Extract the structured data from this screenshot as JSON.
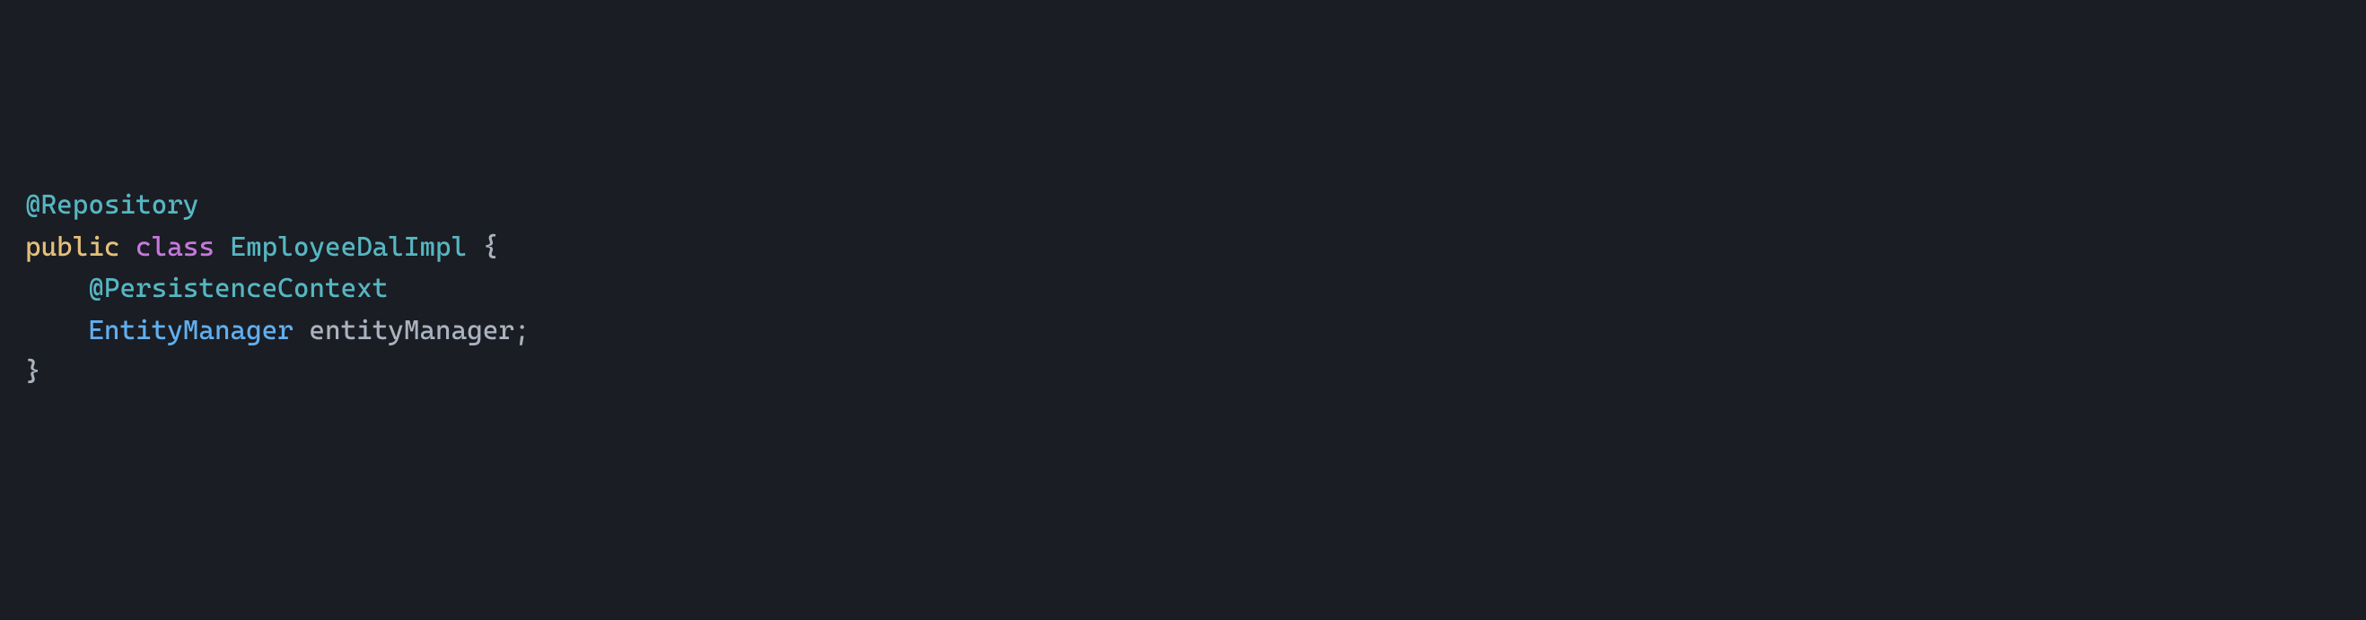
{
  "code": {
    "line1": {
      "annotation": "@Repository"
    },
    "line2": {
      "keyword_public": "public",
      "keyword_class": "class",
      "class_name": "EmployeeDalImpl",
      "brace_open": "{"
    },
    "line3": {
      "empty": ""
    },
    "line4": {
      "indent": "    ",
      "annotation": "@PersistenceContext"
    },
    "line5": {
      "indent": "    ",
      "type": "EntityManager",
      "identifier": "entityManager",
      "semicolon": ";"
    },
    "line6": {
      "empty": ""
    },
    "line7": {
      "empty": ""
    },
    "line8": {
      "brace_close": "}"
    }
  }
}
